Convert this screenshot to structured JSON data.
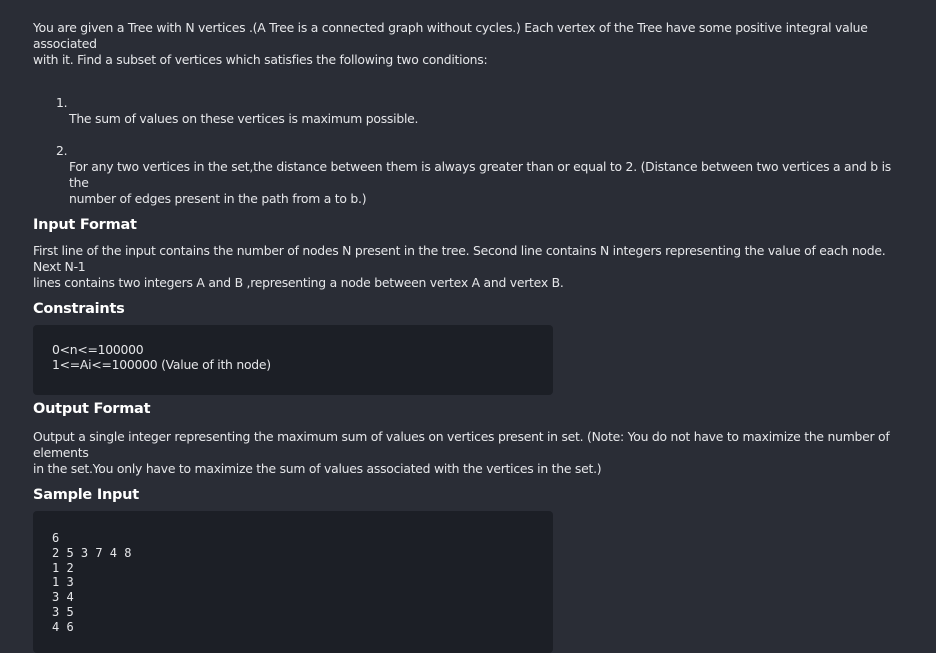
{
  "problem": {
    "description": "You are given a Tree with N vertices .(A Tree is a connected graph without cycles.) Each vertex of the Tree have some positive integral value associated\nwith it. Find a subset of vertices which satisfies the following two conditions:",
    "conditions": [
      {
        "num": "1.",
        "text": "The sum of values on these vertices is maximum possible."
      },
      {
        "num": "2.",
        "text": "For any two vertices in the set,the distance between them is always greater than or equal to 2. (Distance between two vertices a and b is the\nnumber of edges present in the path from a to b.)"
      }
    ]
  },
  "input_format": {
    "heading": "Input Format",
    "text": "First line of the input contains the number of nodes N present in the tree. Second line contains N integers representing the value of each node. Next N-1\nlines contains two integers A and B ,representing a node between vertex A and vertex B."
  },
  "constraints": {
    "heading": "Constraints",
    "lines": "0<n<=100000\n1<=Ai<=100000 (Value of ith node)"
  },
  "output_format": {
    "heading": "Output Format",
    "text": "Output a single integer representing the maximum sum of values on vertices present in set. (Note: You do not have to maximize the number of elements\nin the set.You only have to maximize the sum of values associated with the vertices in the set.)"
  },
  "sample_input": {
    "heading": "Sample Input",
    "lines": "6\n2 5 3 7 4 8\n1 2\n1 3\n3 4\n3 5\n4 6"
  }
}
